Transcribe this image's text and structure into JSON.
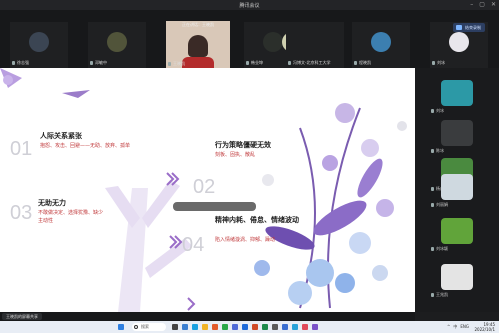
{
  "window": {
    "title": "腾讯会议"
  },
  "speaking": {
    "label": "正在讲话：王晓凯"
  },
  "record_button": {
    "label": "结束录制"
  },
  "top_participants": [
    {
      "name": "徐志强",
      "color": "#3b4553"
    },
    {
      "name": "邓敏中",
      "color": "#51543a"
    },
    {
      "name": "王晓凯",
      "color": "#e9d7c8"
    },
    {
      "name": "韩业坤",
      "color": "#2b2f2b"
    },
    {
      "name": "冯博文-北京科工大学",
      "color": "#cfd0b0"
    },
    {
      "name": "程晓凯",
      "color": "#3c7fb0"
    },
    {
      "name": "刘冰",
      "color": "#e8e6ec"
    }
  ],
  "right_participants": [
    {
      "name": "刘冰",
      "color": "#2c99a6"
    },
    {
      "name": "陈冰",
      "color": "#3a3c3e"
    },
    {
      "name": "杨成",
      "color": "#4a8a3f"
    },
    {
      "name": "刘丽娟",
      "color": "#cfd9e0"
    },
    {
      "name": "刘冰颖",
      "color": "#61a43a"
    },
    {
      "name": "王兆凯",
      "color": "#e4e4e4"
    }
  ],
  "slide": {
    "n1": "01",
    "item1_title": "人际关系紧张",
    "item1_body": "抱怨、攻击、回避——无助、放弃、孤单",
    "n2": "02",
    "item2_title": "行为策略僵硬无效",
    "item2_body": "刻板、固执、散乱",
    "n3": "03",
    "item3_title": "无助无力",
    "item3_body": "不敢做决定、选择犹豫、缺少主动性",
    "n4": "04",
    "item4_title": "精神内耗、倦怠、情绪波动",
    "item4_body": "陷入情绪漩涡、抑郁、躁动"
  },
  "status": {
    "speaker_chip": "王晓凯的屏幕共享"
  },
  "taskbar": {
    "search_placeholder": "搜索",
    "time": "19:45",
    "date": "2022/10/1",
    "tray": [
      "^",
      "中",
      "ENG"
    ]
  }
}
